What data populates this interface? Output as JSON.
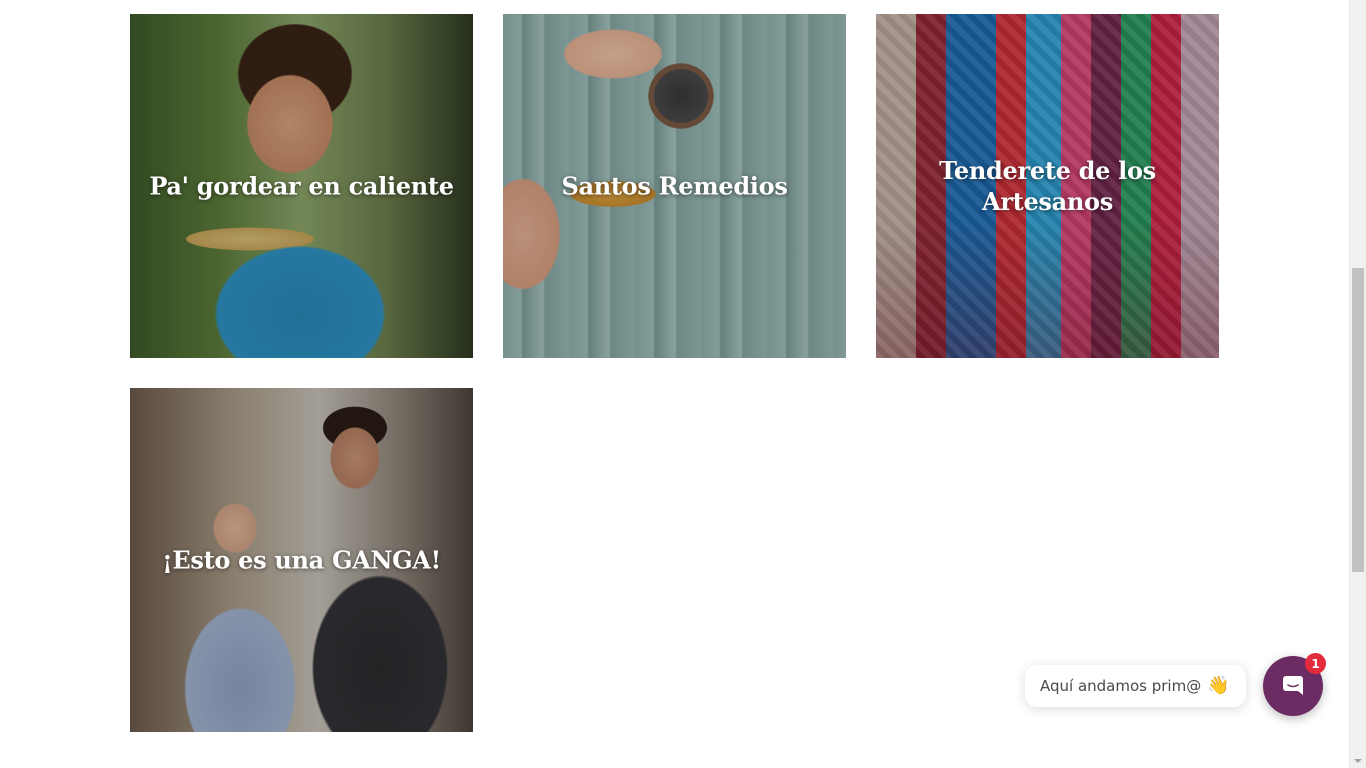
{
  "categories": [
    {
      "title": "Pa' gordear en caliente"
    },
    {
      "title": "Santos Remedios"
    },
    {
      "title": "Tenderete de los Artesanos"
    },
    {
      "title": "¡Esto es una GANGA!"
    }
  ],
  "chat": {
    "greeting": "Aquí andamos prim@",
    "emoji": "👋",
    "badge_count": "1",
    "icon": "chat-bubble-icon",
    "brand_color": "#6b2c63",
    "badge_color": "#e22b3c"
  }
}
